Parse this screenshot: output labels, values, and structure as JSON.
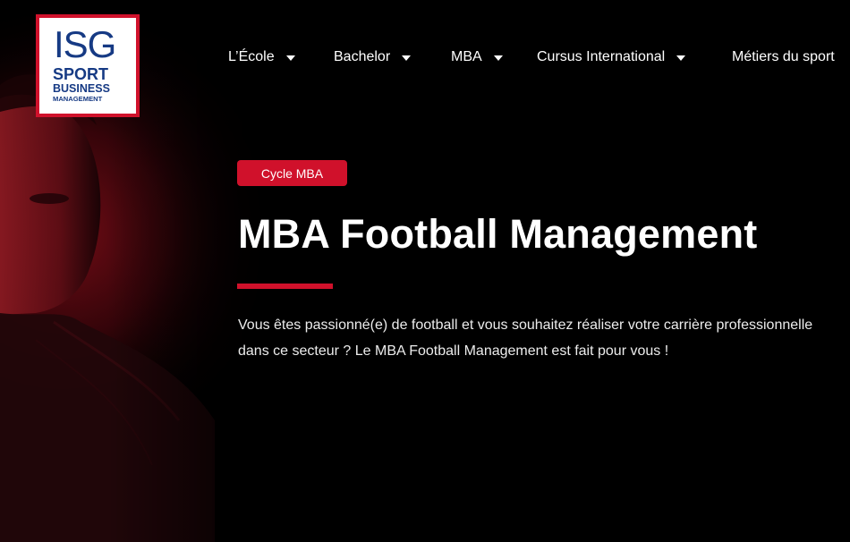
{
  "logo": {
    "line1": "ISG",
    "line2": "SPORT",
    "line3": "BUSINESS",
    "line4": "MANAGEMENT"
  },
  "nav": {
    "items": [
      {
        "label": "L’École",
        "has_dropdown": true
      },
      {
        "label": "Bachelor",
        "has_dropdown": true
      },
      {
        "label": "MBA",
        "has_dropdown": true
      },
      {
        "label": "Cursus International",
        "has_dropdown": true
      },
      {
        "label": "Métiers du sport",
        "has_dropdown": false
      }
    ]
  },
  "hero": {
    "badge": "Cycle MBA",
    "title": "MBA Football Management",
    "description": "Vous êtes passionné(e) de football et vous souhaitez réaliser votre carrière professionnelle dans ce secteur ? Le MBA Football Management est fait pour vous !"
  },
  "colors": {
    "accent": "#d0112b",
    "background": "#000000",
    "logo_blue": "#163a84",
    "text": "#ffffff"
  },
  "icons": {
    "dropdown": "caret-down-icon"
  }
}
